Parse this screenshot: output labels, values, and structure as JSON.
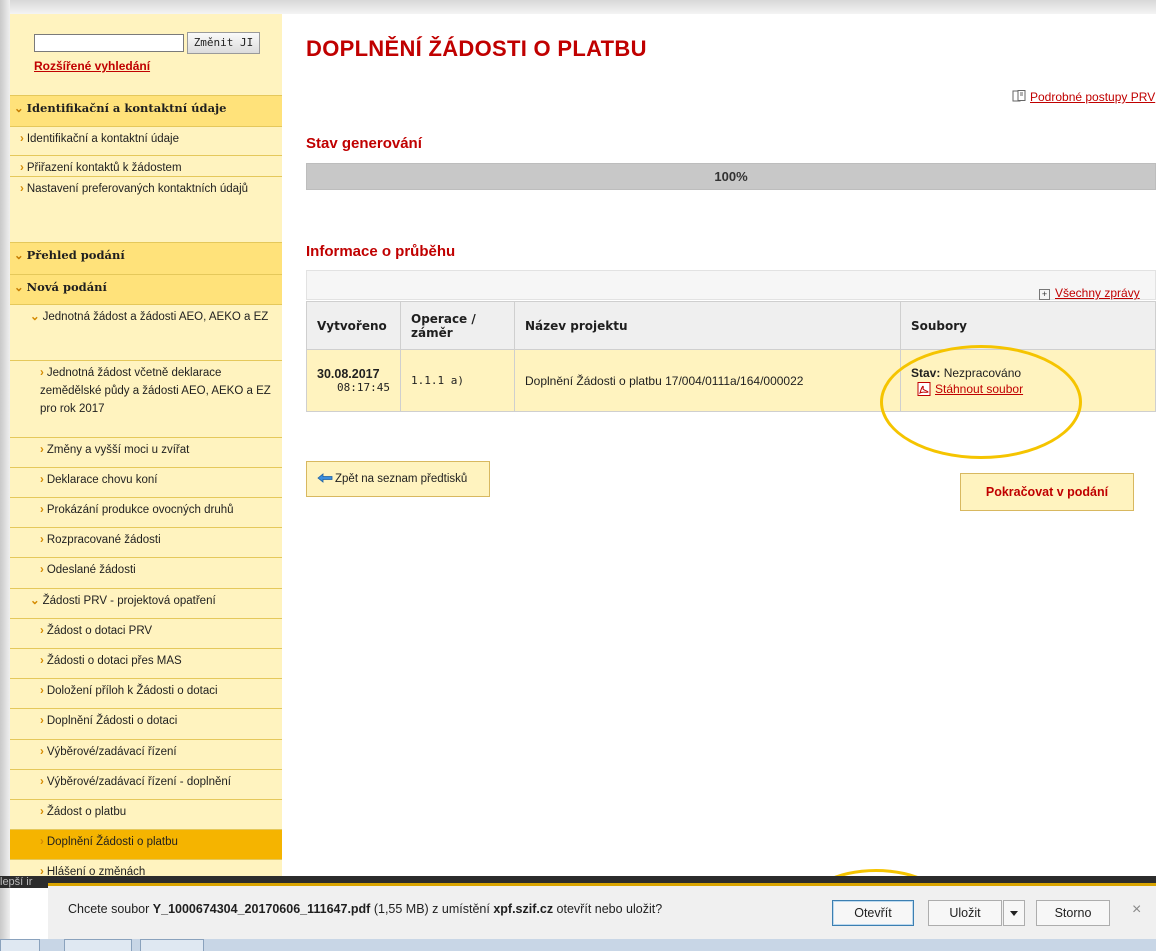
{
  "sidebar": {
    "search_button": "Změnit JI",
    "advanced_search": "Rozšířené vyhledání",
    "items": [
      {
        "label": "Identifikační a kontaktní údaje",
        "level": "top"
      },
      {
        "label": "Identifikační a kontaktní údaje",
        "level": "lvl1"
      },
      {
        "label": "Přiřazení kontaktů k žádostem",
        "level": "lvl1"
      },
      {
        "label": "Nastavení preferovaných kontaktních údajů",
        "level": "lvl1"
      },
      {
        "label": "Přehled podání",
        "level": "top"
      },
      {
        "label": "Nová podání",
        "level": "top"
      },
      {
        "label": "Jednotná žádost a žádosti AEO, AEKO a EZ",
        "level": "lvl2"
      },
      {
        "label": "Jednotná žádost včetně deklarace zemědělské půdy a žádosti AEO, AEKO a EZ pro rok 2017",
        "level": "lvl3"
      },
      {
        "label": "Změny a vyšší moci u zvířat",
        "level": "lvl3"
      },
      {
        "label": "Deklarace chovu koní",
        "level": "lvl3"
      },
      {
        "label": "Prokázání produkce ovocných druhů",
        "level": "lvl3"
      },
      {
        "label": "Rozpracované žádosti",
        "level": "lvl3"
      },
      {
        "label": "Odeslané žádosti",
        "level": "lvl3"
      },
      {
        "label": "Žádosti PRV - projektová opatření",
        "level": "lvl2"
      },
      {
        "label": "Žádost o dotaci PRV",
        "level": "lvl3"
      },
      {
        "label": "Žádosti o dotaci přes MAS",
        "level": "lvl3"
      },
      {
        "label": "Doložení příloh k Žádosti o dotaci",
        "level": "lvl3"
      },
      {
        "label": "Doplnění Žádosti o dotaci",
        "level": "lvl3"
      },
      {
        "label": "Výběrové/zadávací řízení",
        "level": "lvl3"
      },
      {
        "label": "Výběrové/zadávací řízení - doplnění",
        "level": "lvl3"
      },
      {
        "label": "Žádost o platbu",
        "level": "lvl3"
      },
      {
        "label": "Doplnění Žádosti o platbu",
        "level": "lvl3",
        "active": true
      },
      {
        "label": "Hlášení o změnách",
        "level": "lvl3"
      }
    ]
  },
  "main": {
    "title": "DOPLNĚNÍ ŽÁDOSTI O PLATBU",
    "help_link": "Podrobné postupy PRV",
    "generation_title": "Stav generování",
    "progress_text": "100%",
    "progress_value": 1.0,
    "info_title": "Informace o průběhu",
    "all_messages": "Všechny zprávy",
    "table": {
      "headers": [
        "Vytvořeno",
        "Operace / záměr",
        "Název projektu",
        "Soubory"
      ],
      "row": {
        "date": "30.08.2017",
        "time": "08:17:45",
        "operation": "1.1.1 a)",
        "project": "Doplnění Žádosti o platbu 17/004/0111a/164/000022",
        "status_label": "Stav:",
        "status_value": "Nezpracováno",
        "download": "Stáhnout soubor"
      }
    },
    "back_button": "Zpět na seznam předtisků",
    "continue_button": "Pokračovat v podání"
  },
  "download_bar": {
    "strip_text": "lepší ir",
    "msg_prefix": "Chcete soubor ",
    "file_name": "Y_1000674304_20170606_111647.pdf",
    "file_size": " (1,55 MB) z umístění ",
    "source": "xpf.szif.cz",
    "msg_suffix": " otevřít nebo uložit?",
    "open": "Otevřít",
    "save": "Uložit",
    "cancel": "Storno",
    "close": "×"
  },
  "colors": {
    "accent_red": "#c00000",
    "sidebar_bg": "#fff3bf",
    "sidebar_header": "#ffe27a",
    "sidebar_active": "#f5b400",
    "highlight_circle": "#f5c400"
  }
}
